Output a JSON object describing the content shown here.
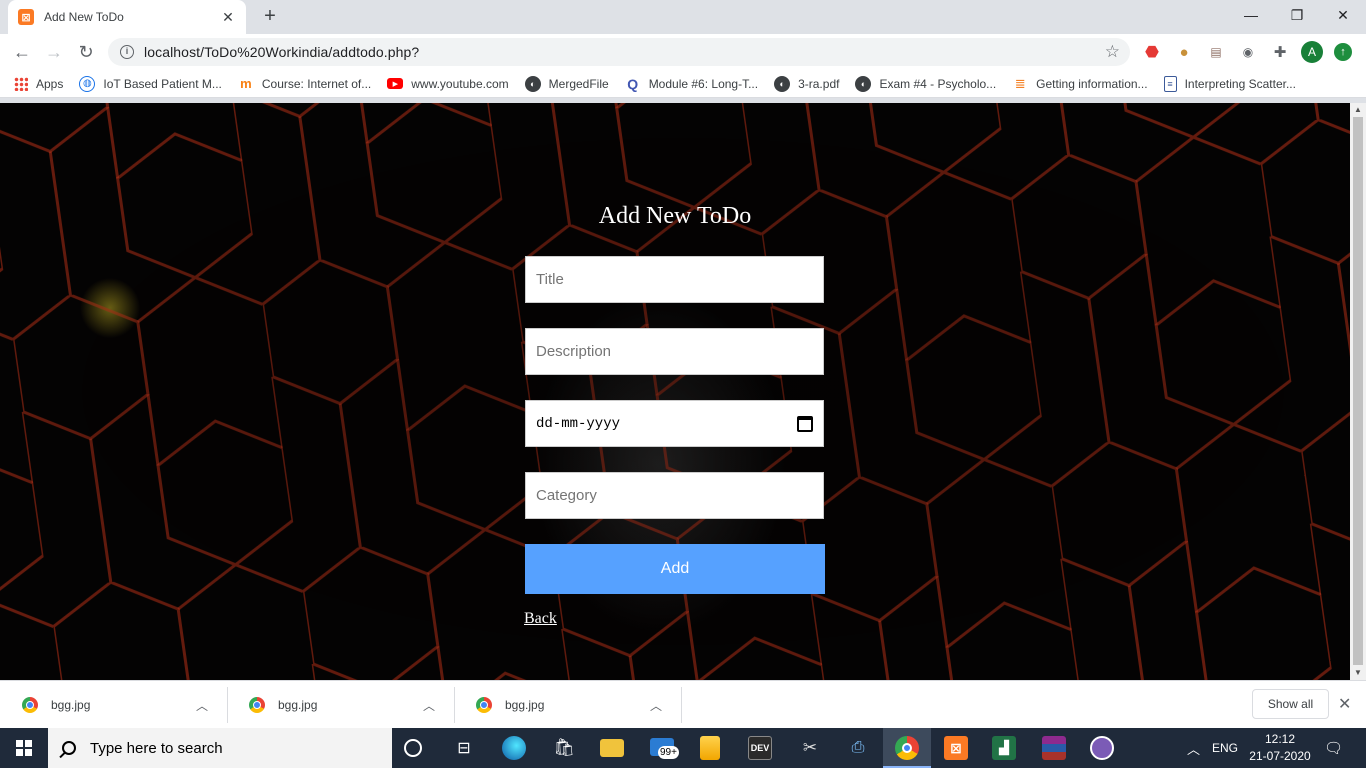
{
  "browser": {
    "tab_title": "Add New ToDo",
    "url": "localhost/ToDo%20Workindia/addtodo.php?",
    "profile_initial": "A"
  },
  "bookmarks": [
    {
      "label": "Apps",
      "icon": "apps-grid-icon"
    },
    {
      "label": "IoT Based Patient M...",
      "icon": "globe-icon"
    },
    {
      "label": "Course: Internet of...",
      "icon": "moodle-icon"
    },
    {
      "label": "www.youtube.com",
      "icon": "youtube-icon"
    },
    {
      "label": "MergedFile",
      "icon": "globe-icon"
    },
    {
      "label": "Module #6: Long-T...",
      "icon": "quizlet-icon"
    },
    {
      "label": "3-ra.pdf",
      "icon": "globe-icon"
    },
    {
      "label": "Exam #4 - Psycholo...",
      "icon": "globe-icon"
    },
    {
      "label": "Getting information...",
      "icon": "stackoverflow-icon"
    },
    {
      "label": "Interpreting Scatter...",
      "icon": "document-icon"
    }
  ],
  "form": {
    "heading": "Add New ToDo",
    "title_placeholder": "Title",
    "description_placeholder": "Description",
    "date_placeholder": "dd-mm-yyyy",
    "category_placeholder": "Category",
    "submit_label": "Add",
    "back_label": "Back"
  },
  "downloads": {
    "items": [
      {
        "name": "bgg.jpg"
      },
      {
        "name": "bgg.jpg"
      },
      {
        "name": "bgg.jpg"
      }
    ],
    "show_all_label": "Show all"
  },
  "taskbar": {
    "search_placeholder": "Type here to search",
    "mail_badge": "99+",
    "language": "ENG",
    "time": "12:12",
    "date": "21-07-2020"
  },
  "colors": {
    "add_button": "#56a1ff",
    "page_background": "#050303",
    "hex_glow": "#c8341a"
  }
}
